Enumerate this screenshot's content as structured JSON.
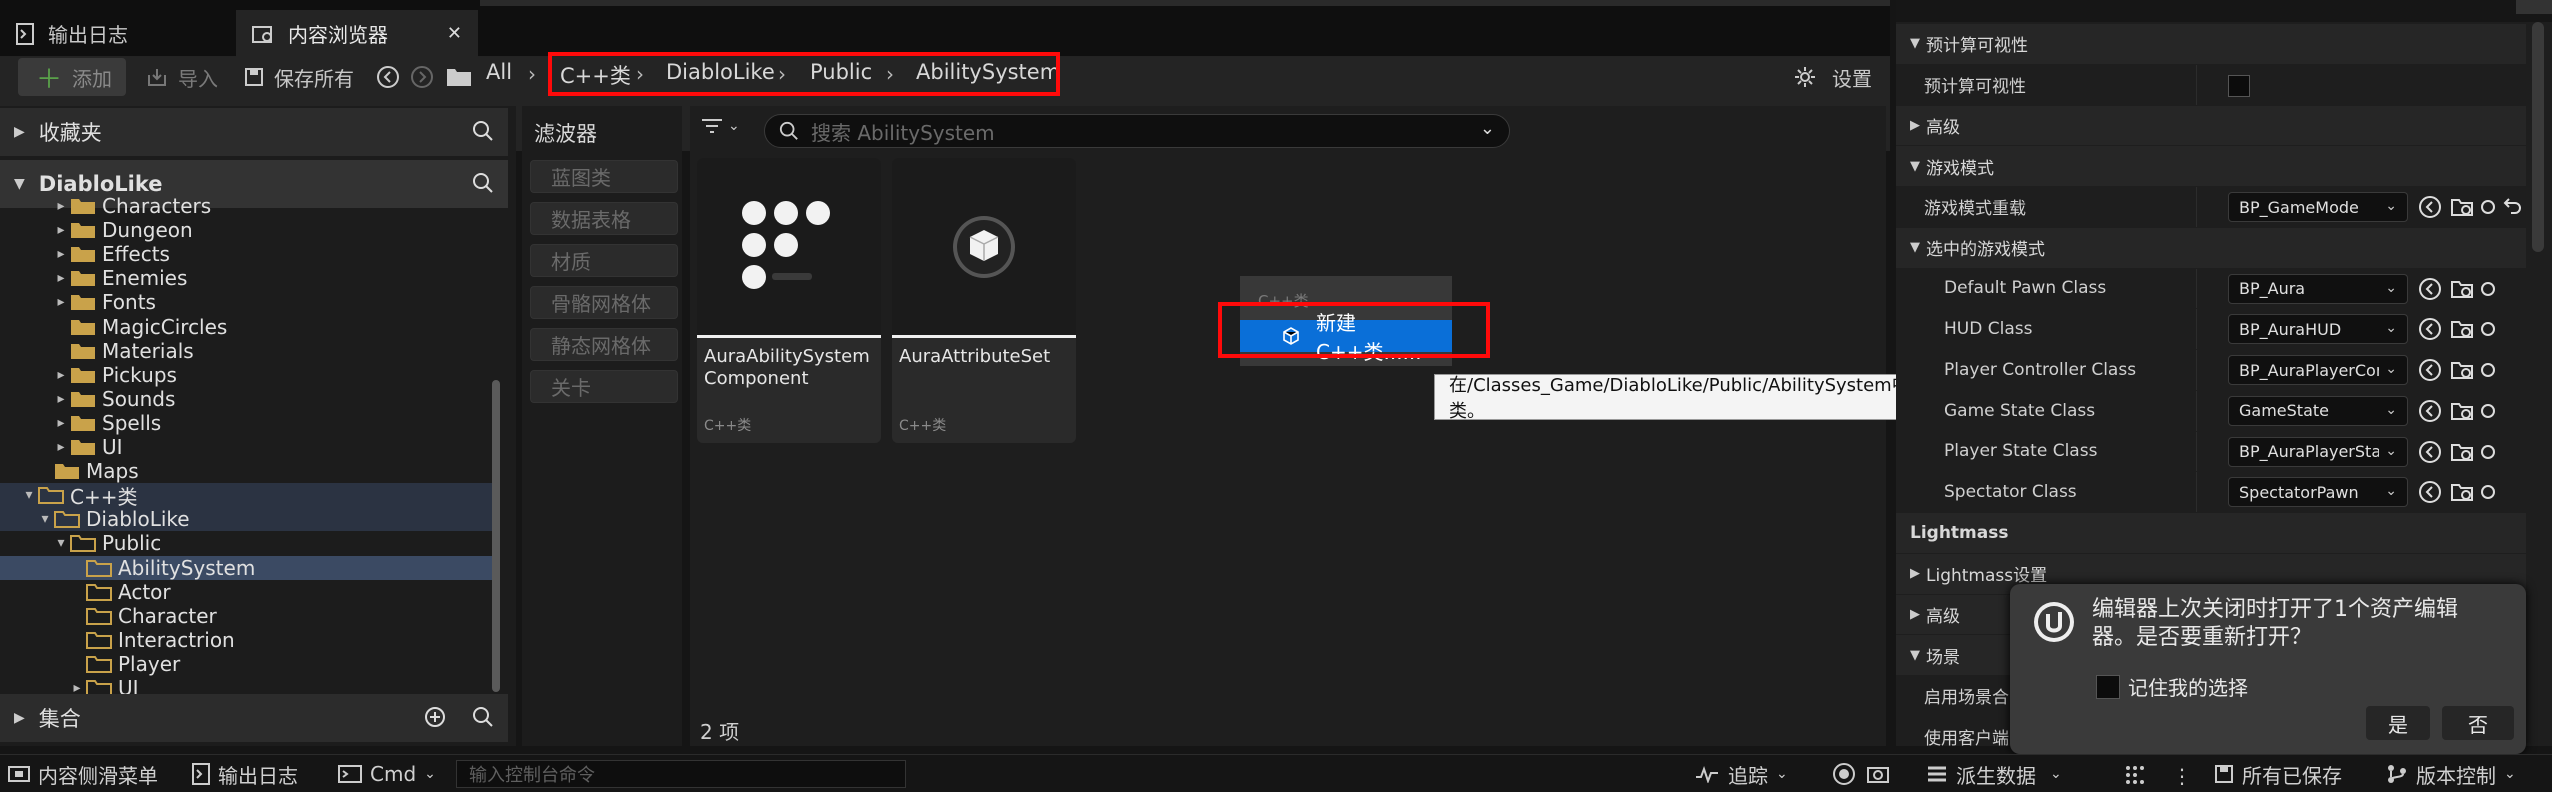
{
  "tabs": [
    {
      "label": "输出日志"
    },
    {
      "label": "内容浏览器"
    }
  ],
  "toolbar": {
    "add_label": "添加",
    "import_label": "导入",
    "save_all_label": "保存所有",
    "settings_label": "设置"
  },
  "breadcrumb": [
    "All",
    "C++类",
    "DiabloLike",
    "Public",
    "AbilitySystem"
  ],
  "left_panel": {
    "favorites_label": "收藏夹",
    "project_label": "DiabloLike",
    "collections_label": "集合",
    "tree": [
      {
        "label": "Characters",
        "indent": 2,
        "expander": true,
        "type": "folder"
      },
      {
        "label": "Dungeon",
        "indent": 2,
        "expander": true,
        "type": "folder"
      },
      {
        "label": "Effects",
        "indent": 2,
        "expander": true,
        "type": "folder"
      },
      {
        "label": "Enemies",
        "indent": 2,
        "expander": true,
        "type": "folder"
      },
      {
        "label": "Fonts",
        "indent": 2,
        "expander": true,
        "type": "folder"
      },
      {
        "label": "MagicCircles",
        "indent": 2,
        "expander": false,
        "type": "folder"
      },
      {
        "label": "Materials",
        "indent": 2,
        "expander": false,
        "type": "folder"
      },
      {
        "label": "Pickups",
        "indent": 2,
        "expander": true,
        "type": "folder"
      },
      {
        "label": "Sounds",
        "indent": 2,
        "expander": true,
        "type": "folder"
      },
      {
        "label": "Spells",
        "indent": 2,
        "expander": true,
        "type": "folder"
      },
      {
        "label": "UI",
        "indent": 2,
        "expander": true,
        "type": "folder"
      },
      {
        "label": "Maps",
        "indent": 1,
        "expander": false,
        "type": "folder"
      },
      {
        "label": "C++类",
        "indent": 0,
        "expander": true,
        "open": true,
        "type": "cpp",
        "alt": true
      },
      {
        "label": "DiabloLike",
        "indent": 1,
        "expander": true,
        "open": true,
        "type": "cpp",
        "alt": true
      },
      {
        "label": "Public",
        "indent": 2,
        "expander": true,
        "open": true,
        "type": "cpp"
      },
      {
        "label": "AbilitySystem",
        "indent": 3,
        "expander": false,
        "type": "cpp",
        "selected": true
      },
      {
        "label": "Actor",
        "indent": 3,
        "expander": false,
        "type": "cpp"
      },
      {
        "label": "Character",
        "indent": 3,
        "expander": false,
        "type": "cpp"
      },
      {
        "label": "Interactrion",
        "indent": 3,
        "expander": false,
        "type": "cpp"
      },
      {
        "label": "Player",
        "indent": 3,
        "expander": false,
        "type": "cpp"
      },
      {
        "label": "UI",
        "indent": 3,
        "expander": true,
        "type": "cpp"
      }
    ]
  },
  "filters": {
    "title": "滤波器",
    "items": [
      "蓝图类",
      "数据表格",
      "材质",
      "骨骼网格体",
      "静态网格体",
      "关卡"
    ]
  },
  "content": {
    "search_placeholder": "搜索 AbilitySystem",
    "item_count": "2 项",
    "assets": [
      {
        "name": "AuraAbilitySystem Component",
        "type": "C++类"
      },
      {
        "name": "AuraAttributeSet",
        "type": "C++类"
      }
    ],
    "context_menu": {
      "header": "C++类",
      "item": "新建C++类......"
    },
    "tooltip": "在/Classes_Game/DiabloLike/Public/AbilitySystem中创建一个新类。"
  },
  "details": {
    "rows": [
      {
        "kind": "cat",
        "label": "预计算可视性",
        "expander": true
      },
      {
        "kind": "prop",
        "label": "预计算可视性",
        "checkbox": true
      },
      {
        "kind": "cat",
        "label": "高级",
        "expander": true
      },
      {
        "kind": "cat",
        "label": "游戏模式",
        "expander": true
      },
      {
        "kind": "prop",
        "label": "游戏模式重载",
        "value": "BP_GameMode",
        "reset": true
      },
      {
        "kind": "cat",
        "label": "选中的游戏模式",
        "expander": true
      },
      {
        "kind": "sub",
        "label": "Default Pawn Class",
        "value": "BP_Aura"
      },
      {
        "kind": "sub",
        "label": "HUD Class",
        "value": "BP_AuraHUD"
      },
      {
        "kind": "sub",
        "label": "Player Controller Class",
        "value": "BP_AuraPlayerCon"
      },
      {
        "kind": "sub",
        "label": "Game State Class",
        "value": "GameState"
      },
      {
        "kind": "sub",
        "label": "Player State Class",
        "value": "BP_AuraPlayerStat"
      },
      {
        "kind": "sub",
        "label": "Spectator Class",
        "value": "SpectatorPawn"
      },
      {
        "kind": "cat",
        "label": "Lightmass",
        "bold": true
      },
      {
        "kind": "cat",
        "label": "Lightmass设置",
        "expander": true
      },
      {
        "kind": "cat",
        "label": "高级",
        "expander": true
      },
      {
        "kind": "cat",
        "label": "场景",
        "expander": true
      },
      {
        "kind": "prop",
        "label": "启用场景合"
      },
      {
        "kind": "prop",
        "label": "使用客户端"
      }
    ]
  },
  "dialog": {
    "message": "编辑器上次关闭时打开了1个资产编辑器。是否要重新打开？",
    "checkbox_label": "记住我的选择",
    "yes_label": "是",
    "no_label": "否"
  },
  "statusbar": {
    "content_drawer": "内容侧滑菜单",
    "output_log": "输出日志",
    "cmd_label": "Cmd",
    "console_placeholder": "输入控制台命令",
    "trace_label": "追踪",
    "derived_data_label": "派生数据",
    "saved_label": "所有已保存",
    "source_control_label": "版本控制"
  },
  "colors": {
    "highlight_red": "#ff0a0a",
    "selection_blue": "#0a6fd8",
    "folder_yellow": "#c9a24a"
  }
}
